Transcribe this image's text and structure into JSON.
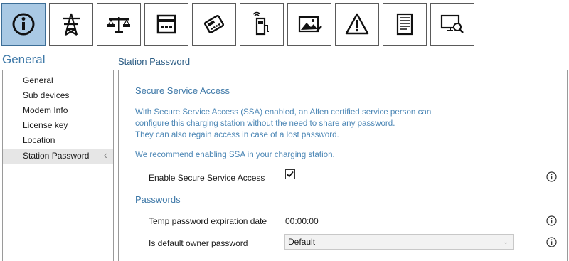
{
  "toolbar": {
    "buttons": [
      {
        "icon": "info-icon",
        "active": true
      },
      {
        "icon": "power-tower-icon",
        "active": false
      },
      {
        "icon": "balance-scale-icon",
        "active": false
      },
      {
        "icon": "card-reader-icon",
        "active": false
      },
      {
        "icon": "payment-terminal-icon",
        "active": false
      },
      {
        "icon": "charging-station-icon",
        "active": false
      },
      {
        "icon": "picture-edit-icon",
        "active": false
      },
      {
        "icon": "warning-icon",
        "active": false
      },
      {
        "icon": "document-icon",
        "active": false
      },
      {
        "icon": "monitor-search-icon",
        "active": false
      }
    ],
    "active_color": "#a9c9e4"
  },
  "section_title": "General",
  "page_title": "Station Password",
  "sidebar": {
    "items": [
      {
        "label": "General"
      },
      {
        "label": "Sub devices"
      },
      {
        "label": "Modem Info"
      },
      {
        "label": "License key"
      },
      {
        "label": "Location"
      },
      {
        "label": "Station Password",
        "selected": true
      }
    ],
    "chevron": "‹"
  },
  "main": {
    "ssa_heading": "Secure Service Access",
    "ssa_description": [
      "With Secure Service Access (SSA) enabled, an Alfen certified service person can",
      "configure this charging station without the need to share any password.",
      "They can also regain access in case of a lost password."
    ],
    "recommendation": "We recommend enabling SSA in your charging station.",
    "enable_ssa": {
      "label": "Enable Secure Service Access",
      "checked": true
    },
    "passwords_heading": "Passwords",
    "temp_expiration": {
      "label": "Temp password expiration date",
      "value": "00:00:00"
    },
    "default_owner": {
      "label": "Is default owner password",
      "value": "Default"
    }
  },
  "colors": {
    "heading": "#3f79a8",
    "text_blue": "#4b86b5"
  }
}
